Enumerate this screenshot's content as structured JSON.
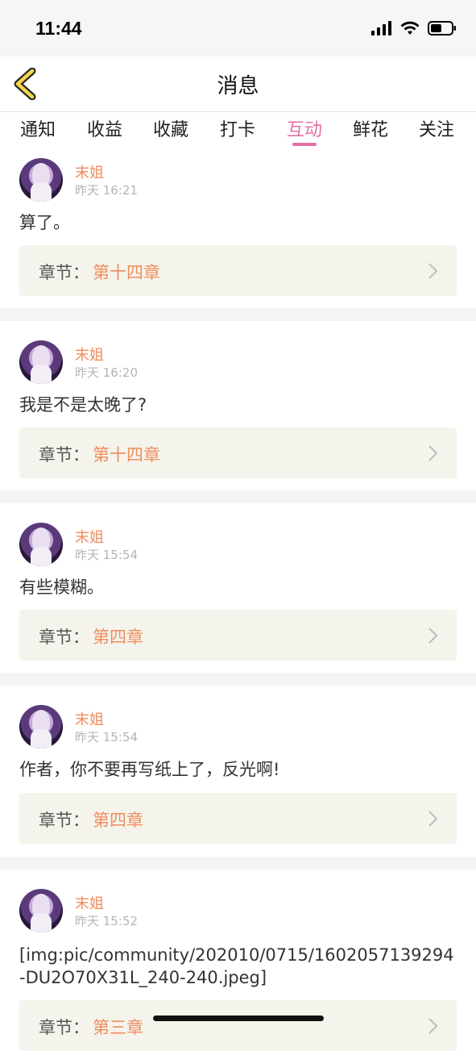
{
  "status_bar": {
    "time": "11:44"
  },
  "nav": {
    "title": "消息"
  },
  "tabs": [
    {
      "label": "通知",
      "active": false
    },
    {
      "label": "收益",
      "active": false
    },
    {
      "label": "收藏",
      "active": false
    },
    {
      "label": "打卡",
      "active": false
    },
    {
      "label": "互动",
      "active": true
    },
    {
      "label": "鲜花",
      "active": false
    },
    {
      "label": "关注",
      "active": false
    }
  ],
  "messages": [
    {
      "user": "末姐",
      "time": "昨天 16:21",
      "content": "算了。",
      "chapter_label": "章节：",
      "chapter": "第十四章"
    },
    {
      "user": "末姐",
      "time": "昨天 16:20",
      "content": "我是不是太晚了?",
      "chapter_label": "章节：",
      "chapter": "第十四章"
    },
    {
      "user": "末姐",
      "time": "昨天 15:54",
      "content": "有些模糊。",
      "chapter_label": "章节：",
      "chapter": "第四章"
    },
    {
      "user": "末姐",
      "time": "昨天 15:54",
      "content": "作者，你不要再写纸上了，反光啊!",
      "chapter_label": "章节：",
      "chapter": "第四章"
    },
    {
      "user": "末姐",
      "time": "昨天 15:52",
      "content": "[img:pic/community/202010/0715/1602057139294-DU2O70X31L_240-240.jpeg]",
      "chapter_label": "章节：",
      "chapter": "第三章"
    }
  ],
  "colors": {
    "accent": "#e46fa7",
    "username": "#ee8e5e",
    "chapter_bg": "#f4f4ec"
  },
  "icons": {
    "back": "chevron-left-icon",
    "chapter_arrow": "chevron-right-icon"
  }
}
